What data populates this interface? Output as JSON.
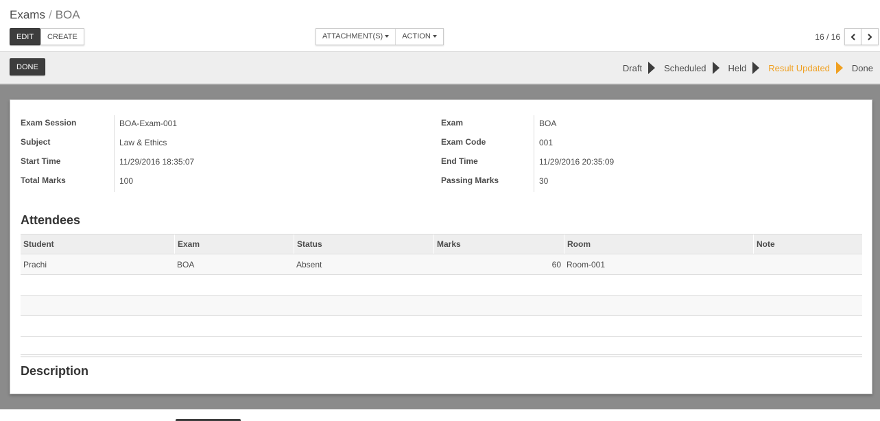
{
  "breadcrumb": {
    "parent": "Exams",
    "separator": "/",
    "current": "BOA"
  },
  "toolbar": {
    "edit_label": "EDIT",
    "create_label": "CREATE",
    "attachments_label": "ATTACHMENT(S)",
    "action_label": "ACTION"
  },
  "pager": {
    "counter": "16 / 16"
  },
  "statusbar": {
    "done_label": "DONE",
    "stages": [
      "Draft",
      "Scheduled",
      "Held",
      "Result Updated",
      "Done"
    ],
    "current_stage": "Result Updated",
    "accent_color": "#f0a020"
  },
  "form": {
    "left": [
      {
        "label": "Exam Session",
        "value": "BOA-Exam-001"
      },
      {
        "label": "Subject",
        "value": "Law & Ethics"
      },
      {
        "label": "Start Time",
        "value": "11/29/2016 18:35:07"
      },
      {
        "label": "Total Marks",
        "value": "100"
      }
    ],
    "right": [
      {
        "label": "Exam",
        "value": "BOA"
      },
      {
        "label": "Exam Code",
        "value": "001"
      },
      {
        "label": "End Time",
        "value": "11/29/2016 20:35:09"
      },
      {
        "label": "Passing Marks",
        "value": "30"
      }
    ]
  },
  "attendees": {
    "title": "Attendees",
    "columns": [
      "Student",
      "Exam",
      "Status",
      "Marks",
      "Room",
      "Note"
    ],
    "rows": [
      {
        "student": "Prachi",
        "exam": "BOA",
        "status": "Absent",
        "marks": "60",
        "room": "Room-001",
        "note": ""
      }
    ]
  },
  "description": {
    "title": "Description"
  }
}
